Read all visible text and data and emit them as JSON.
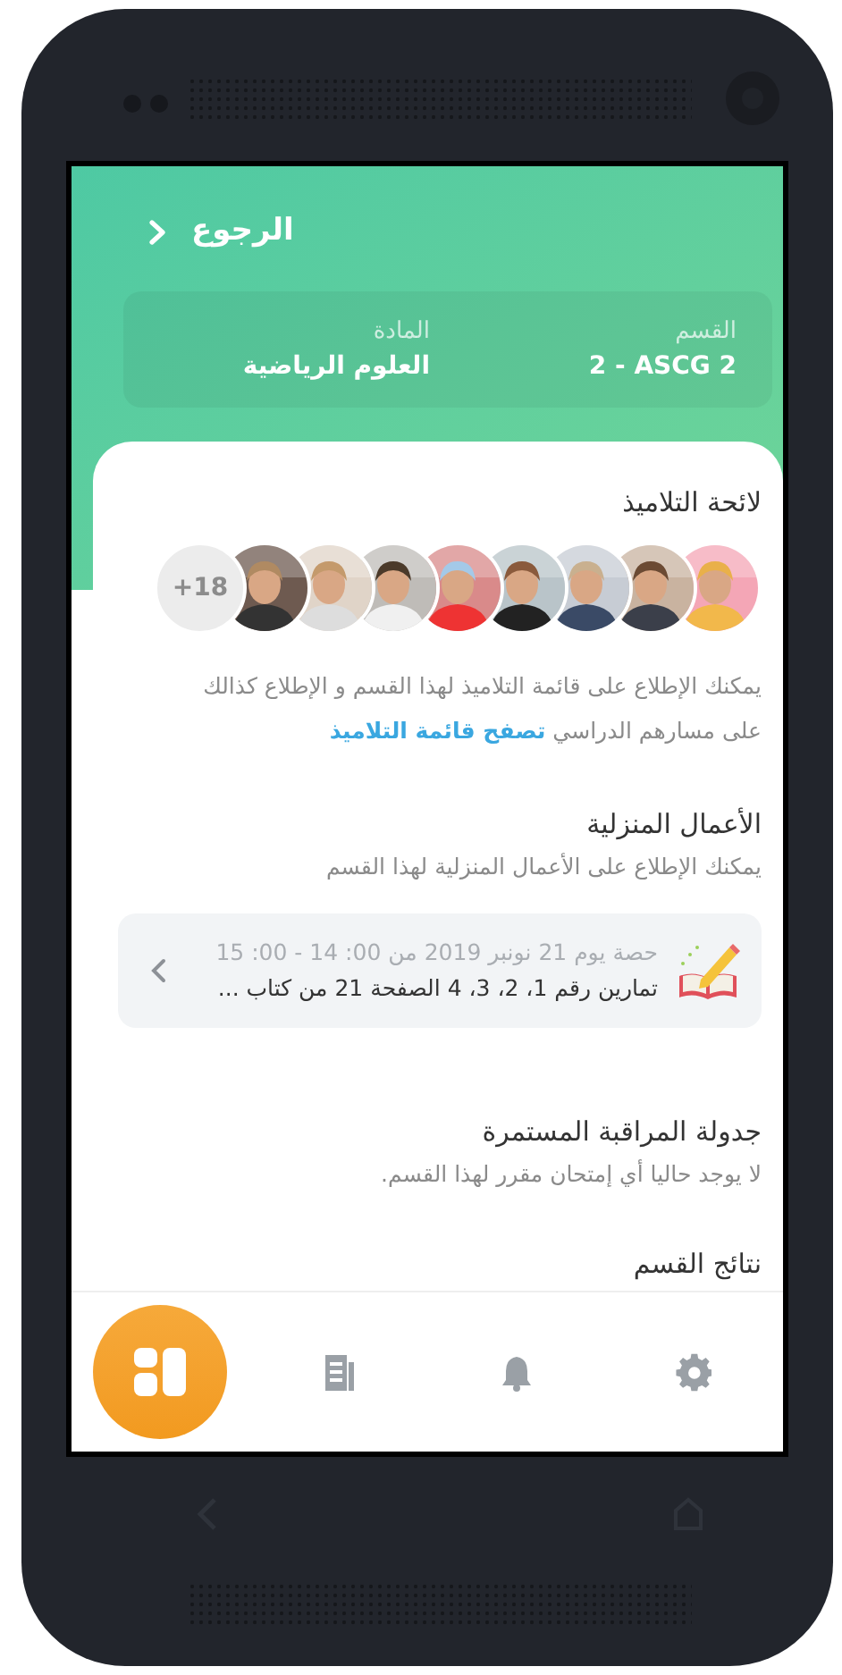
{
  "header": {
    "back_label": "الرجوع"
  },
  "info": [
    {
      "label": "القسم",
      "value": "2 - ASCG 2"
    },
    {
      "label": "المادة",
      "value": "العلوم الرياضية"
    }
  ],
  "students": {
    "title": "لائحة التلاميذ",
    "more_count": "+18",
    "description": "يمكنك الإطلاع على قائمة التلاميذ لهذا القسم و الإطلاع كذالك على مسارهم الدراسي",
    "link": "تصفح قائمة التلاميذ"
  },
  "homework": {
    "title": "الأعمال المنزلية",
    "subtitle": "يمكنك الإطلاع على الأعمال المنزلية لهذا القسم",
    "items": [
      {
        "date": "حصة يوم 21 نونبر 2019 من 00: 14 - 00: 15",
        "text": "تمارين رقم 1، 2، 3، 4 الصفحة 21 من كتاب ..."
      }
    ]
  },
  "exams": {
    "title": "جدولة المراقبة المستمرة",
    "subtitle": "لا يوجد حاليا أي إمتحان مقرر لهذا القسم."
  },
  "next_section": {
    "title": "نتائج القسم"
  },
  "nav": [
    {
      "kind": "logo",
      "selected": true
    },
    {
      "kind": "document",
      "selected": false
    },
    {
      "kind": "bell",
      "selected": false
    },
    {
      "kind": "gear",
      "selected": false
    }
  ]
}
